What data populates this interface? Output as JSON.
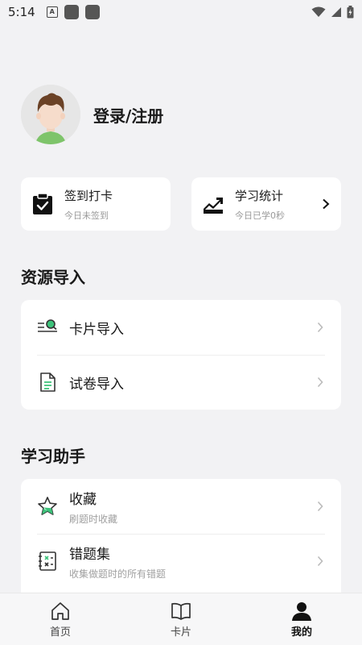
{
  "status_bar": {
    "time": "5:14",
    "notif_letter": "A"
  },
  "profile": {
    "name": "登录/注册"
  },
  "quick_cards": [
    {
      "title": "签到打卡",
      "subtitle": "今日未签到",
      "icon": "calendar-check-icon"
    },
    {
      "title": "学习统计",
      "subtitle": "今日已学0秒",
      "icon": "trend-chart-icon"
    }
  ],
  "resource_section": {
    "title": "资源导入",
    "items": [
      {
        "title": "卡片导入",
        "icon": "card-search-icon"
      },
      {
        "title": "试卷导入",
        "icon": "document-icon"
      }
    ]
  },
  "helper_section": {
    "title": "学习助手",
    "items": [
      {
        "title": "收藏",
        "subtitle": "刷题时收藏",
        "icon": "star-icon"
      },
      {
        "title": "错题集",
        "subtitle": "收集做题时的所有错题",
        "icon": "notebook-x-icon"
      }
    ]
  },
  "bottom_nav": [
    {
      "label": "首页",
      "icon": "home-icon"
    },
    {
      "label": "卡片",
      "icon": "book-icon"
    },
    {
      "label": "我的",
      "icon": "user-icon",
      "active": true
    }
  ],
  "colors": {
    "accent": "#3cc27a",
    "background": "#f2f2f4"
  }
}
